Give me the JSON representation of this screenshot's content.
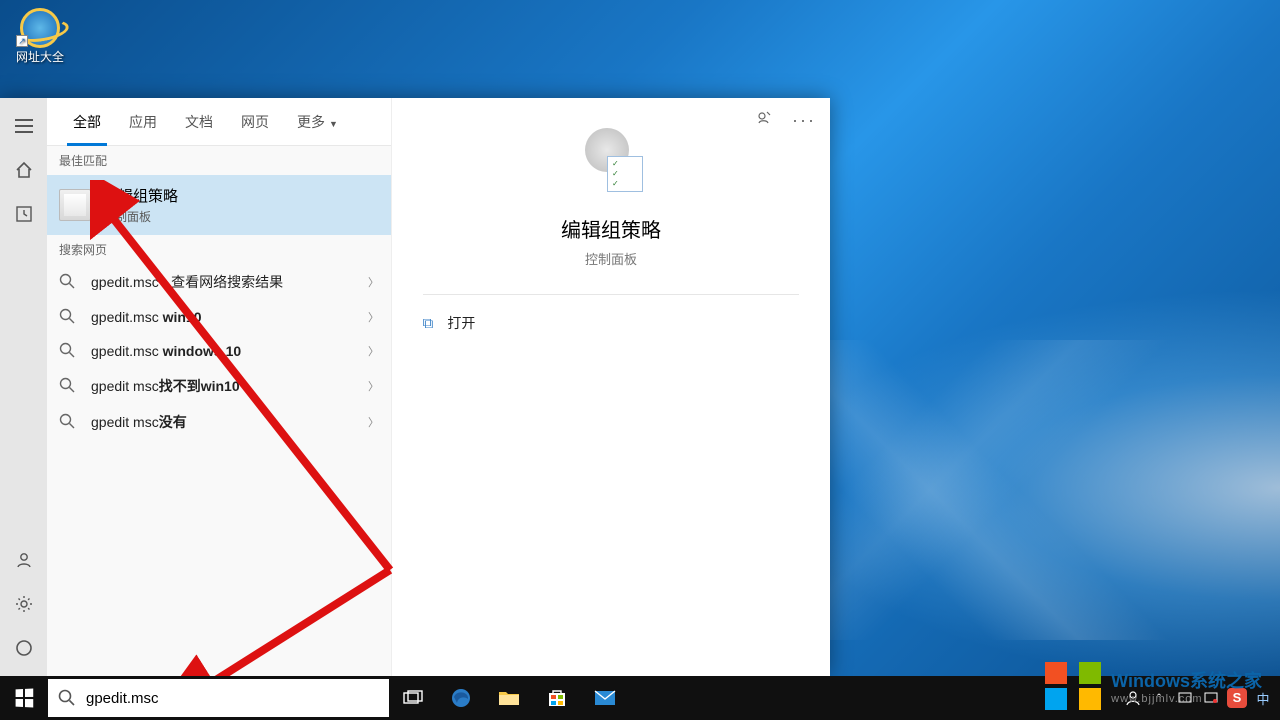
{
  "desktop": {
    "shortcut_label": "网址大全"
  },
  "search": {
    "tabs": [
      "全部",
      "应用",
      "文档",
      "网页",
      "更多"
    ],
    "active_tab": 0,
    "sections": {
      "best_match_header": "最佳匹配",
      "web_header": "搜索网页"
    },
    "best_match": {
      "title": "编辑组策略",
      "subtitle": "控制面板"
    },
    "web_results": [
      {
        "prefix": "gpedit.msc",
        "suffix": " - 查看网络搜索结果"
      },
      {
        "prefix": "gpedit.msc ",
        "bold": "win10"
      },
      {
        "prefix": "gpedit.msc ",
        "bold": "windows 10"
      },
      {
        "prefix": "gpedit msc",
        "bold": "找不到win10"
      },
      {
        "prefix": "gpedit msc",
        "bold": "没有"
      }
    ],
    "preview": {
      "title": "编辑组策略",
      "subtitle": "控制面板",
      "open_label": "打开"
    },
    "input_value": "gpedit.msc"
  },
  "taskbar": {
    "icons": [
      "task-view-icon",
      "edge-icon",
      "explorer-icon",
      "store-icon",
      "mail-icon"
    ]
  },
  "watermark": {
    "brand_en": "Windows",
    "brand_cn": "系统之家",
    "url": "www.bjjmlv.com"
  }
}
